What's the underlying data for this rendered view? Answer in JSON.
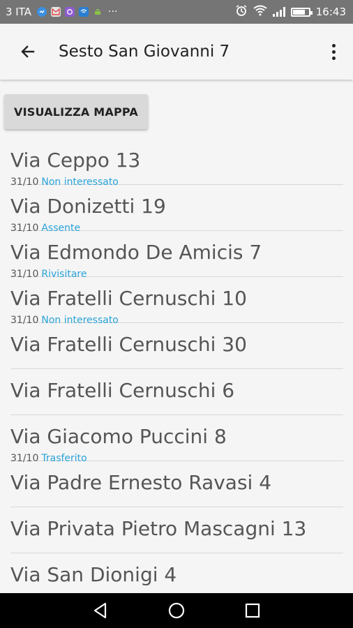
{
  "status_bar": {
    "carrier": "3 ITA",
    "time": "16:43",
    "battery_level": 0.8,
    "notification_icons": [
      "messenger-icon",
      "gmail-icon",
      "viber-icon",
      "wifi-app-icon",
      "android-icon",
      "more-notifications-icon"
    ]
  },
  "app_bar": {
    "title": "Sesto San Giovanni 7"
  },
  "map_button": {
    "label": "VISUALIZZA MAPPA"
  },
  "addresses": [
    {
      "name": "Via Ceppo 13",
      "date": "31/10",
      "status": "Non interessato"
    },
    {
      "name": "Via Donizetti 19",
      "date": "31/10",
      "status": "Assente"
    },
    {
      "name": "Via Edmondo De Amicis 7",
      "date": "31/10",
      "status": "Rivisitare"
    },
    {
      "name": "Via Fratelli Cernuschi 10",
      "date": "31/10",
      "status": "Non interessato"
    },
    {
      "name": "Via Fratelli Cernuschi 30",
      "date": "",
      "status": ""
    },
    {
      "name": "Via Fratelli Cernuschi 6",
      "date": "",
      "status": ""
    },
    {
      "name": "Via Giacomo Puccini 8",
      "date": "31/10",
      "status": "Trasferito"
    },
    {
      "name": "Via Padre Ernesto Ravasi 4",
      "date": "",
      "status": ""
    },
    {
      "name": "Via Privata Pietro Mascagni 13",
      "date": "",
      "status": ""
    },
    {
      "name": "Via San Dionigi 4",
      "date": "",
      "status": ""
    }
  ],
  "colors": {
    "status_text": "#29a3d8",
    "status_bar_bg": "#757575",
    "nav_bar_bg": "#000000"
  }
}
